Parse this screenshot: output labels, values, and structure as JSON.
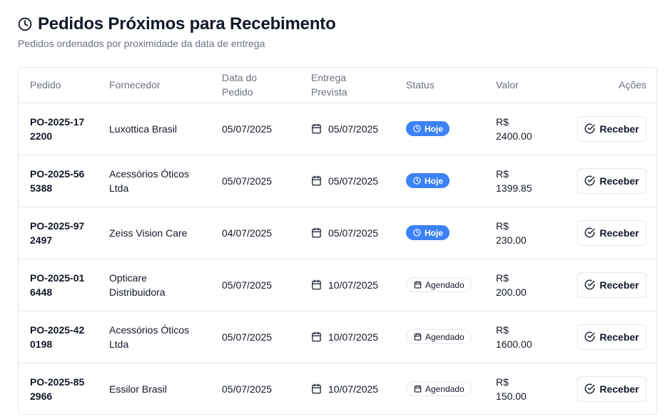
{
  "header": {
    "title": "Pedidos Próximos para Recebimento",
    "subtitle": "Pedidos ordenados por proximidade da data de entrega",
    "icon": "clock-icon"
  },
  "table": {
    "columns": [
      "Pedido",
      "Fornecedor",
      "Data do Pedido",
      "Entrega Prevista",
      "Status",
      "Valor",
      "Ações"
    ],
    "rows": [
      {
        "order": "PO-2025-172200",
        "supplier": "Luxottica Brasil",
        "order_date": "05/07/2025",
        "delivery": "05/07/2025",
        "status": "Hoje",
        "status_type": "today",
        "value": "R$ 2400.00",
        "action": "Receber"
      },
      {
        "order": "PO-2025-565388",
        "supplier": "Acessórios Óticos Ltda",
        "order_date": "05/07/2025",
        "delivery": "05/07/2025",
        "status": "Hoje",
        "status_type": "today",
        "value": "R$ 1399.85",
        "action": "Receber"
      },
      {
        "order": "PO-2025-972497",
        "supplier": "Zeiss Vision Care",
        "order_date": "04/07/2025",
        "delivery": "05/07/2025",
        "status": "Hoje",
        "status_type": "today",
        "value": "R$ 230.00",
        "action": "Receber"
      },
      {
        "order": "PO-2025-016448",
        "supplier": "Opticare Distribuidora",
        "order_date": "05/07/2025",
        "delivery": "10/07/2025",
        "status": "Agendado",
        "status_type": "scheduled",
        "value": "R$ 200.00",
        "action": "Receber"
      },
      {
        "order": "PO-2025-420198",
        "supplier": "Acessórios Óticos Ltda",
        "order_date": "05/07/2025",
        "delivery": "10/07/2025",
        "status": "Agendado",
        "status_type": "scheduled",
        "value": "R$ 1600.00",
        "action": "Receber"
      },
      {
        "order": "PO-2025-852966",
        "supplier": "Essilor Brasil",
        "order_date": "05/07/2025",
        "delivery": "10/07/2025",
        "status": "Agendado",
        "status_type": "scheduled",
        "value": "R$ 150.00",
        "action": "Receber"
      }
    ]
  },
  "colors": {
    "today_badge": "#3b82f6",
    "border": "#e5e7eb",
    "muted_text": "#6b7280"
  }
}
